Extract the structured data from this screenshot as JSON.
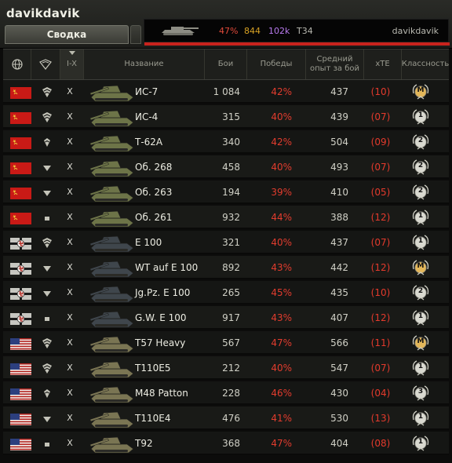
{
  "header": {
    "username": "davikdavik",
    "tab_summary": "Сводка"
  },
  "compare": {
    "winrate": "47%",
    "battles": "844",
    "exp": "102k",
    "tank": "T34",
    "player": "davikdavik"
  },
  "columns": {
    "nation_icon": "globe-icon",
    "type_icon": "tank-type-icon",
    "tier": "I-X",
    "name": "Название",
    "battles": "Бои",
    "wins": "Победы",
    "avg_exp": "Средний опыт за бой",
    "xte": "xTE",
    "mastery": "Классность"
  },
  "colors": {
    "accent_red": "#e23c2e",
    "exp_purple": "#b97bf0",
    "battles_gold": "#d9a324"
  },
  "rows": [
    {
      "nation": "ussr",
      "type": "heavy",
      "tier": "X",
      "name": "ИС-7",
      "battles": "1 084",
      "wins": "42%",
      "exp": "437",
      "xte": "(10)",
      "mastery": "M"
    },
    {
      "nation": "ussr",
      "type": "heavy",
      "tier": "X",
      "name": "ИС-4",
      "battles": "315",
      "wins": "40%",
      "exp": "439",
      "xte": "(07)",
      "mastery": "1"
    },
    {
      "nation": "ussr",
      "type": "medium",
      "tier": "X",
      "name": "Т-62А",
      "battles": "340",
      "wins": "42%",
      "exp": "504",
      "xte": "(09)",
      "mastery": "2"
    },
    {
      "nation": "ussr",
      "type": "td",
      "tier": "X",
      "name": "Об. 268",
      "battles": "458",
      "wins": "40%",
      "exp": "493",
      "xte": "(07)",
      "mastery": "2"
    },
    {
      "nation": "ussr",
      "type": "td",
      "tier": "X",
      "name": "Об. 263",
      "battles": "194",
      "wins": "39%",
      "exp": "410",
      "xte": "(05)",
      "mastery": "2"
    },
    {
      "nation": "ussr",
      "type": "spg",
      "tier": "X",
      "name": "Об. 261",
      "battles": "932",
      "wins": "44%",
      "exp": "388",
      "xte": "(12)",
      "mastery": "1"
    },
    {
      "nation": "germany",
      "type": "heavy",
      "tier": "X",
      "name": "E 100",
      "battles": "321",
      "wins": "40%",
      "exp": "437",
      "xte": "(07)",
      "mastery": "1"
    },
    {
      "nation": "germany",
      "type": "td",
      "tier": "X",
      "name": "WT auf E 100",
      "battles": "892",
      "wins": "43%",
      "exp": "442",
      "xte": "(12)",
      "mastery": "M"
    },
    {
      "nation": "germany",
      "type": "td",
      "tier": "X",
      "name": "Jg.Pz. E 100",
      "battles": "265",
      "wins": "45%",
      "exp": "435",
      "xte": "(10)",
      "mastery": "2"
    },
    {
      "nation": "germany",
      "type": "spg",
      "tier": "X",
      "name": "G.W. E 100",
      "battles": "917",
      "wins": "43%",
      "exp": "407",
      "xte": "(12)",
      "mastery": "1"
    },
    {
      "nation": "usa",
      "type": "heavy",
      "tier": "X",
      "name": "T57 Heavy",
      "battles": "567",
      "wins": "47%",
      "exp": "566",
      "xte": "(11)",
      "mastery": "M"
    },
    {
      "nation": "usa",
      "type": "heavy",
      "tier": "X",
      "name": "T110E5",
      "battles": "212",
      "wins": "40%",
      "exp": "547",
      "xte": "(07)",
      "mastery": "1"
    },
    {
      "nation": "usa",
      "type": "medium",
      "tier": "X",
      "name": "M48 Patton",
      "battles": "228",
      "wins": "46%",
      "exp": "430",
      "xte": "(04)",
      "mastery": "3"
    },
    {
      "nation": "usa",
      "type": "td",
      "tier": "X",
      "name": "T110E4",
      "battles": "476",
      "wins": "41%",
      "exp": "530",
      "xte": "(13)",
      "mastery": "1"
    },
    {
      "nation": "usa",
      "type": "spg",
      "tier": "X",
      "name": "T92",
      "battles": "368",
      "wins": "47%",
      "exp": "404",
      "xte": "(08)",
      "mastery": "1"
    }
  ]
}
